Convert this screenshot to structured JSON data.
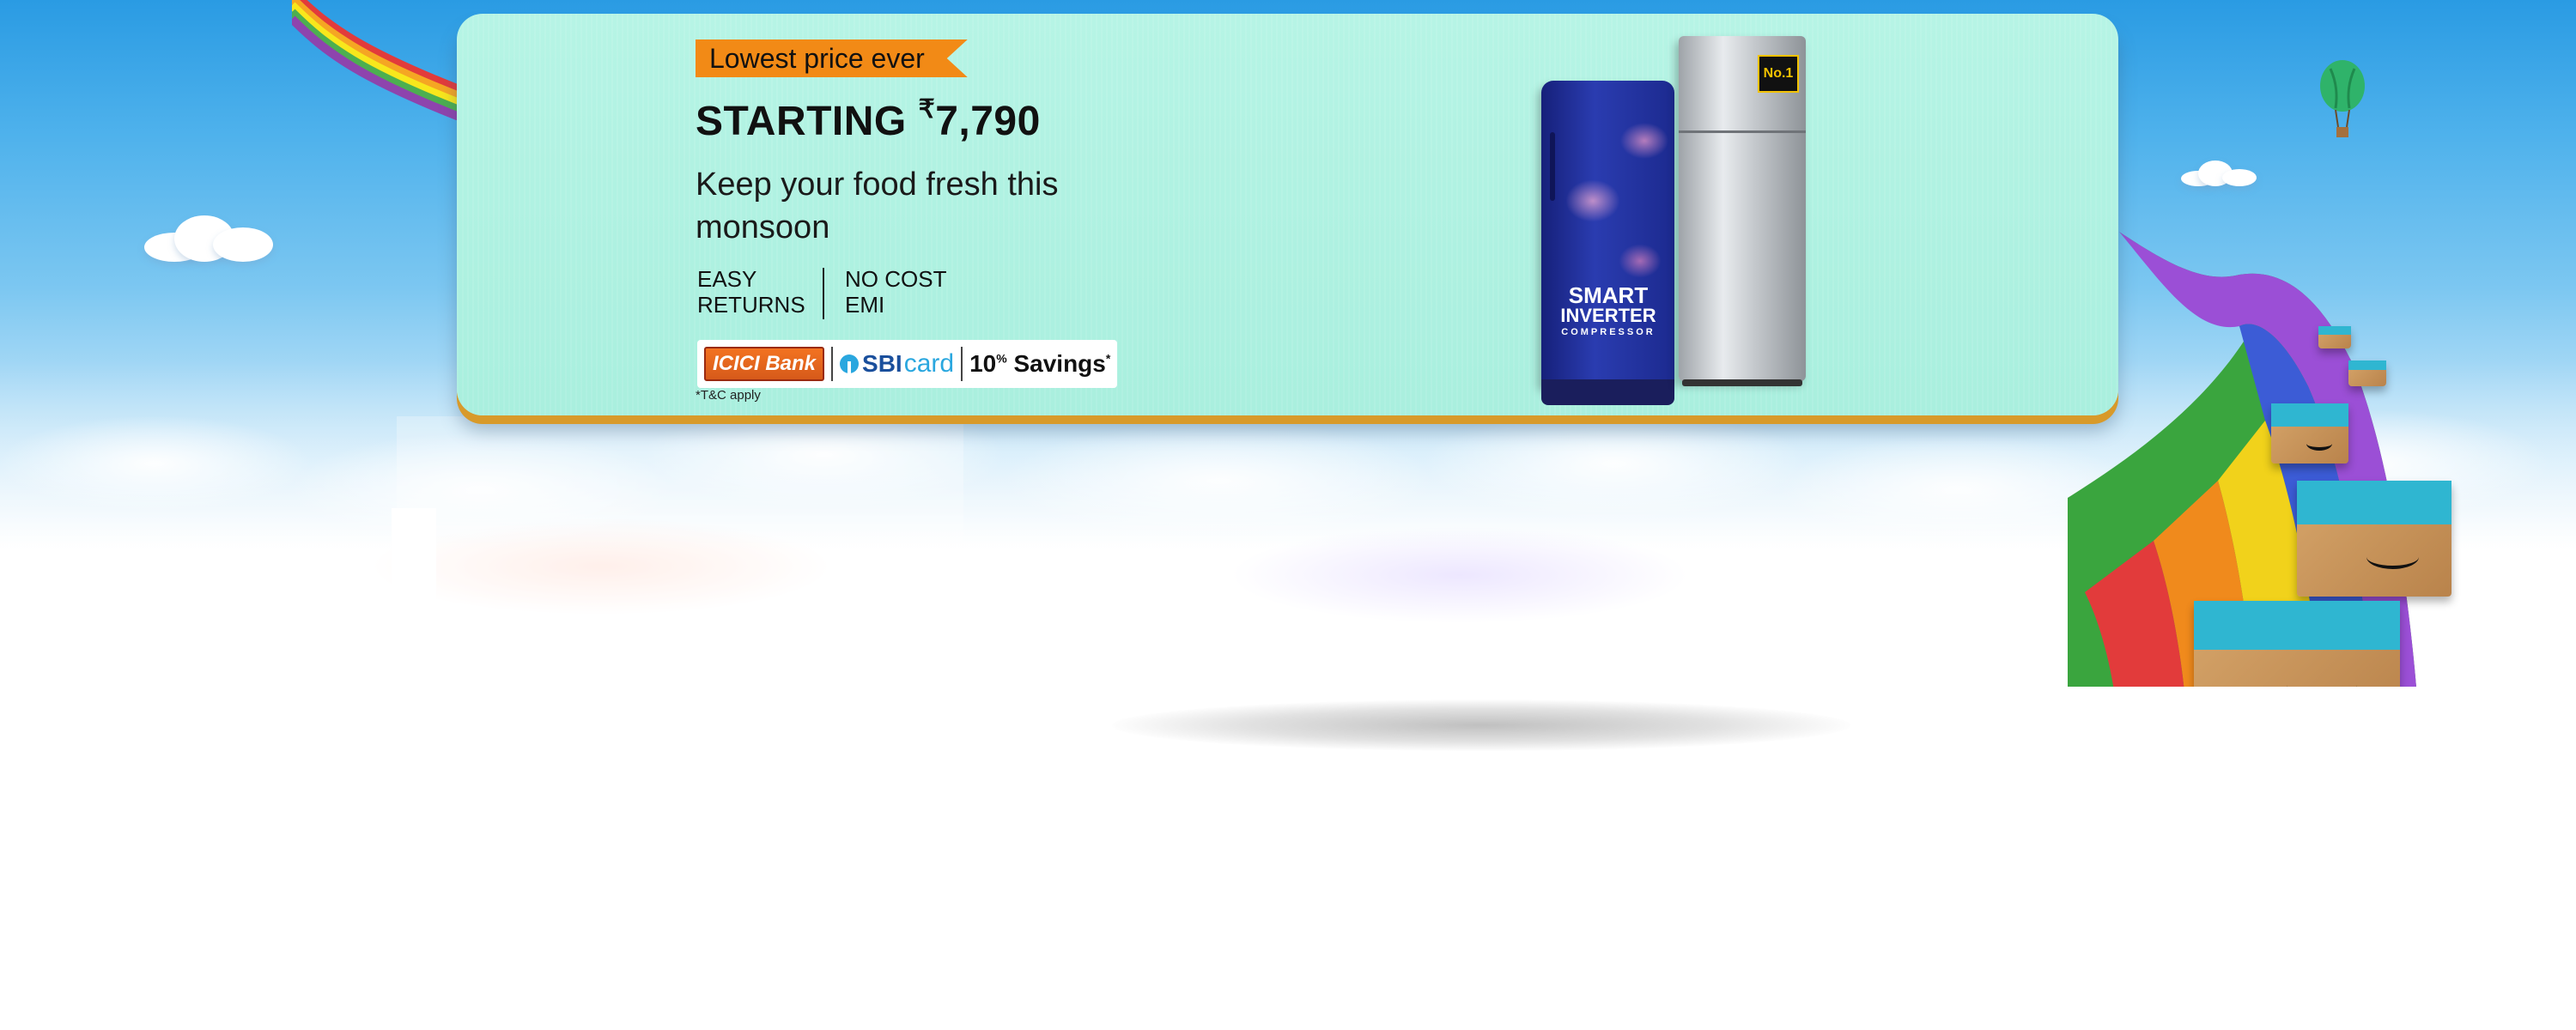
{
  "banner": {
    "tag": "Lowest price ever",
    "headline_prefix": "STARTING",
    "currency": "₹",
    "price": "7,790",
    "subhead": "Keep your food fresh this monsoon",
    "features": [
      {
        "label": "EASY\nRETURNS"
      },
      {
        "label": "NO COST\nEMI"
      }
    ],
    "banks": {
      "icici": "ICICI Bank",
      "sbi": "SBI",
      "sbi_card": "card",
      "savings_value": "10",
      "savings_unit": "%",
      "savings_label": "Savings",
      "savings_mark": "*"
    },
    "tc": "*T&C apply"
  },
  "products": {
    "fridge_label_line1": "SMART",
    "fridge_label_line2": "INVERTER",
    "fridge_label_line3": "COMPRESSOR",
    "badge": "No.1"
  },
  "colors": {
    "banner_bg": "#b6f4e5",
    "tag_bg": "#f28a16",
    "banner_edge": "#d89a2a",
    "sky": "#2a9be3"
  },
  "icons": {
    "balloon": "hot-air-balloon-icon",
    "box": "prime-day-box-icon"
  }
}
